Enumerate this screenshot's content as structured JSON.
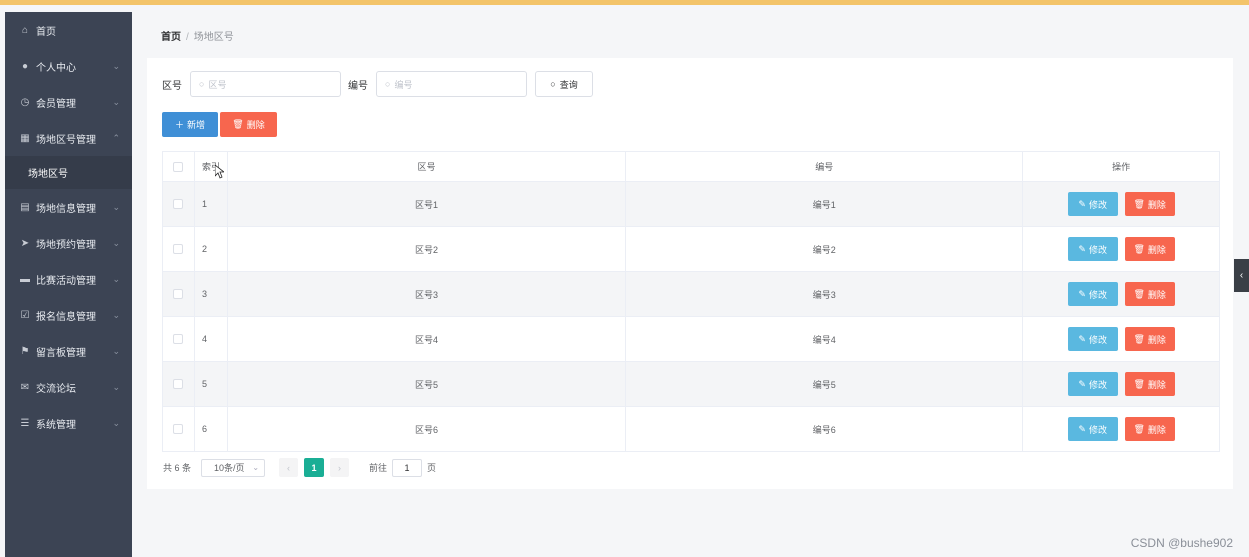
{
  "colors": {
    "topbar": "#f3c46a",
    "sidebar": "#3c4454",
    "primary": "#3f8fd6",
    "danger": "#f7664e",
    "info": "#5ab8e0",
    "pager_active": "#1aae95"
  },
  "sidebar": {
    "items": [
      {
        "label": "首页",
        "icon": "home-icon",
        "glyph": "⌂",
        "arrow": ""
      },
      {
        "label": "个人中心",
        "icon": "user-icon",
        "glyph": "●",
        "arrow": "⌄"
      },
      {
        "label": "会员管理",
        "icon": "clock-icon",
        "glyph": "◷",
        "arrow": "⌄"
      },
      {
        "label": "场地区号管理",
        "icon": "grid-icon",
        "glyph": "▦",
        "arrow": "⌃"
      },
      {
        "label": "场地信息管理",
        "icon": "building-icon",
        "glyph": "▤",
        "arrow": "⌄"
      },
      {
        "label": "场地预约管理",
        "icon": "send-icon",
        "glyph": "➤",
        "arrow": "⌄"
      },
      {
        "label": "比赛活动管理",
        "icon": "bank-icon",
        "glyph": "▬",
        "arrow": "⌄"
      },
      {
        "label": "报名信息管理",
        "icon": "checkbox-icon",
        "glyph": "☑",
        "arrow": "⌄"
      },
      {
        "label": "留言板管理",
        "icon": "flag-icon",
        "glyph": "⚑",
        "arrow": "⌄"
      },
      {
        "label": "交流论坛",
        "icon": "mail-icon",
        "glyph": "✉",
        "arrow": "⌄"
      },
      {
        "label": "系统管理",
        "icon": "settings-icon",
        "glyph": "☰",
        "arrow": "⌄"
      }
    ],
    "active_sub": "场地区号"
  },
  "breadcrumb": {
    "home": "首页",
    "separator": "/",
    "current": "场地区号"
  },
  "search": {
    "zone_label": "区号",
    "zone_placeholder": "区号",
    "code_label": "编号",
    "code_placeholder": "编号",
    "query_button": "查询"
  },
  "actions": {
    "add": "新增",
    "delete": "删除"
  },
  "table": {
    "headers": {
      "index": "索引",
      "zone": "区号",
      "code": "编号",
      "ops": "操作"
    },
    "rows": [
      {
        "index": "1",
        "zone": "区号1",
        "code": "编号1"
      },
      {
        "index": "2",
        "zone": "区号2",
        "code": "编号2"
      },
      {
        "index": "3",
        "zone": "区号3",
        "code": "编号3"
      },
      {
        "index": "4",
        "zone": "区号4",
        "code": "编号4"
      },
      {
        "index": "5",
        "zone": "区号5",
        "code": "编号5"
      },
      {
        "index": "6",
        "zone": "区号6",
        "code": "编号6"
      }
    ],
    "edit_label": "修改",
    "delete_label": "删除"
  },
  "pager": {
    "total": "共 6 条",
    "page_size": "10条/页",
    "current_page": "1",
    "goto_prefix": "前往",
    "goto_value": "1",
    "goto_suffix": "页"
  },
  "watermark": "CSDN @bushe902"
}
